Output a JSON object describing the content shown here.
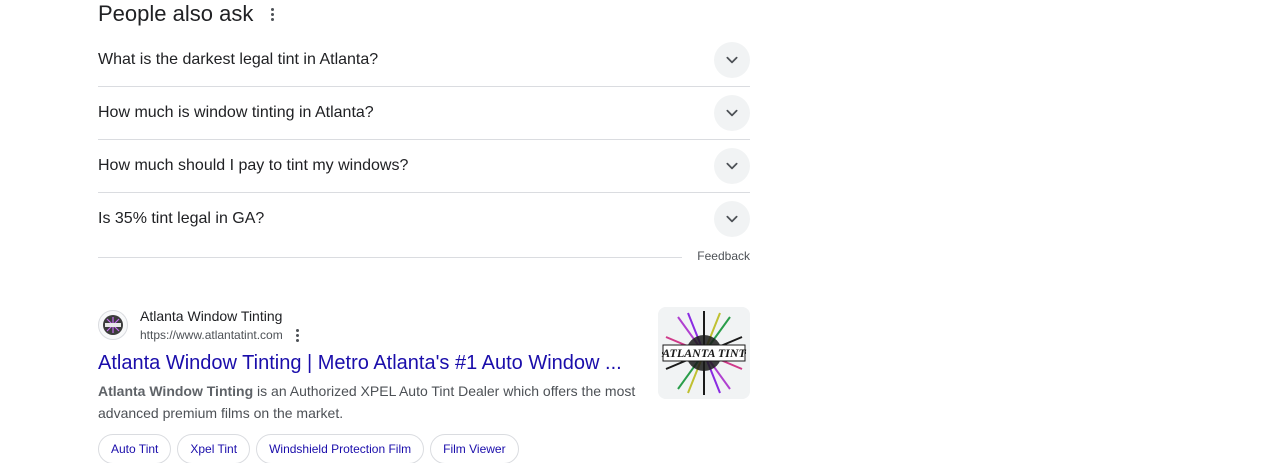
{
  "paa": {
    "title": "People also ask",
    "questions": [
      {
        "text": "What is the darkest legal tint in Atlanta?"
      },
      {
        "text": "How much is window tinting in Atlanta?"
      },
      {
        "text": "How much should I pay to tint my windows?"
      },
      {
        "text": "Is 35% tint legal in GA?"
      }
    ],
    "feedback": "Feedback"
  },
  "result": {
    "site_name": "Atlanta Window Tinting",
    "site_url": "https://www.atlantatint.com",
    "title": "Atlanta Window Tinting | Metro Atlanta's #1 Auto Window ...",
    "snippet_bold": "Atlanta Window Tinting",
    "snippet_rest": " is an Authorized XPEL Auto Tint Dealer which offers the most advanced premium films on the market.",
    "thumbnail_text": "ATLANTA TINT",
    "chips": [
      {
        "label": "Auto Tint"
      },
      {
        "label": "Xpel Tint"
      },
      {
        "label": "Windshield Protection Film"
      },
      {
        "label": "Film Viewer"
      }
    ]
  },
  "colors": {
    "link": "#1a0dab",
    "text": "#202124",
    "secondary": "#4d5156",
    "divider": "#dadce0"
  }
}
